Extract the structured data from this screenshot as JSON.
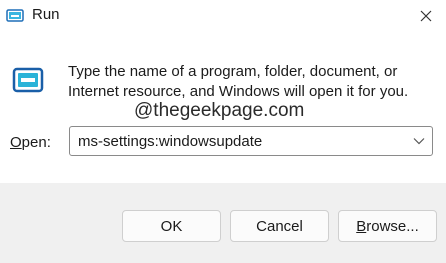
{
  "window": {
    "title": "Run",
    "icon": "run-app-icon",
    "close_icon": "close-icon"
  },
  "main": {
    "icon": "run-app-icon",
    "description": "Type the name of a program, folder, document, or Internet resource, and Windows will open it for you.",
    "watermark": "@thegeekpage.com"
  },
  "open_field": {
    "label_mnemonic": "O",
    "label_rest": "pen:",
    "value": "ms-settings:windowsupdate",
    "dropdown_icon": "chevron-down-icon"
  },
  "buttons": {
    "ok": "OK",
    "cancel": "Cancel",
    "browse_mnemonic": "B",
    "browse_rest": "rowse..."
  },
  "colors": {
    "footer_bg": "#f0f0f0",
    "icon_blue": "#1a73c7",
    "icon_teal": "#2ab3d8"
  }
}
